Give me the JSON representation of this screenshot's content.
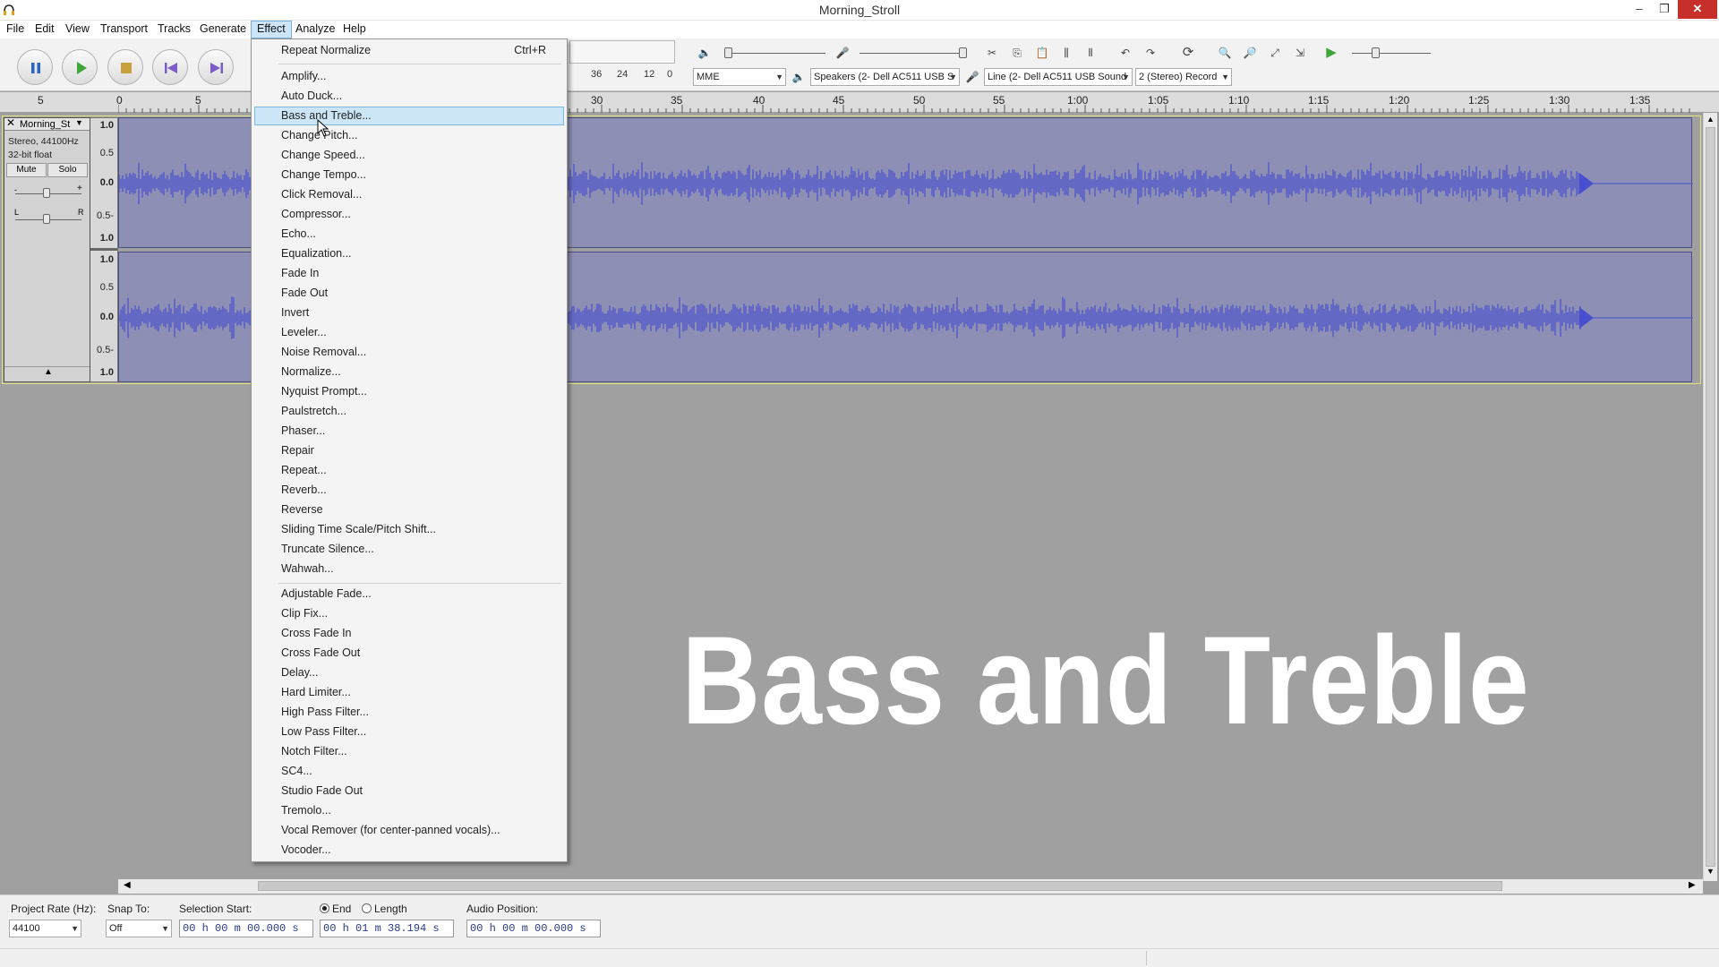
{
  "window": {
    "title": "Morning_Stroll",
    "min_icon": "minimize-icon",
    "max_icon": "restore-icon",
    "close_icon": "close-icon",
    "min_glyph": "–",
    "max_glyph": "❐",
    "close_glyph": "✕"
  },
  "menubar": [
    "File",
    "Edit",
    "View",
    "Transport",
    "Tracks",
    "Generate",
    "Effect",
    "Analyze",
    "Help"
  ],
  "open_menu": "Effect",
  "effect_menu": {
    "items": [
      {
        "label": "Repeat Normalize",
        "accel": "Ctrl+R"
      },
      {
        "label": "Amplify..."
      },
      {
        "label": "Auto Duck..."
      },
      {
        "label": "Bass and Treble...",
        "highlighted": true
      },
      {
        "label": "Change Pitch..."
      },
      {
        "label": "Change Speed..."
      },
      {
        "label": "Change Tempo..."
      },
      {
        "label": "Click Removal..."
      },
      {
        "label": "Compressor..."
      },
      {
        "label": "Echo..."
      },
      {
        "label": "Equalization..."
      },
      {
        "label": "Fade In"
      },
      {
        "label": "Fade Out"
      },
      {
        "label": "Invert"
      },
      {
        "label": "Leveler..."
      },
      {
        "label": "Noise Removal..."
      },
      {
        "label": "Normalize..."
      },
      {
        "label": "Nyquist Prompt..."
      },
      {
        "label": "Paulstretch..."
      },
      {
        "label": "Phaser..."
      },
      {
        "label": "Repair"
      },
      {
        "label": "Repeat..."
      },
      {
        "label": "Reverb..."
      },
      {
        "label": "Reverse"
      },
      {
        "label": "Sliding Time Scale/Pitch Shift..."
      },
      {
        "label": "Truncate Silence..."
      },
      {
        "label": "Wahwah..."
      },
      {
        "label": "Adjustable Fade..."
      },
      {
        "label": "Clip Fix..."
      },
      {
        "label": "Cross Fade In"
      },
      {
        "label": "Cross Fade Out"
      },
      {
        "label": "Delay..."
      },
      {
        "label": "Hard Limiter..."
      },
      {
        "label": "High Pass Filter..."
      },
      {
        "label": "Low Pass Filter..."
      },
      {
        "label": "Notch Filter..."
      },
      {
        "label": "SC4..."
      },
      {
        "label": "Studio Fade Out"
      },
      {
        "label": "Tremolo..."
      },
      {
        "label": "Vocal Remover (for center-panned vocals)..."
      },
      {
        "label": "Vocoder..."
      }
    ]
  },
  "transport": {
    "pause_icon": "pause-icon",
    "play_icon": "play-icon",
    "stop_icon": "stop-icon",
    "skip_start_icon": "skip-to-start-icon",
    "skip_end_icon": "skip-to-end-icon"
  },
  "meter": {
    "ticks": [
      "36",
      "24",
      "12",
      "0"
    ]
  },
  "device": {
    "host": "MME",
    "playback": "Speakers (2- Dell AC511 USB S",
    "recording": "Line (2- Dell AC511 USB Sound",
    "channels": "2 (Stereo) Record"
  },
  "ruler": {
    "labels": [
      "5",
      "0",
      "5",
      "30",
      "35",
      "40",
      "45",
      "50",
      "55",
      "1:00",
      "1:05",
      "1:10",
      "1:15",
      "1:20",
      "1:25",
      "1:30",
      "1:35"
    ]
  },
  "track": {
    "name": "Morning_St",
    "info1": "Stereo, 44100Hz",
    "info2": "32-bit float",
    "mute": "Mute",
    "solo": "Solo",
    "gain_minus": "-",
    "gain_plus": "+",
    "pan_left": "L",
    "pan_right": "R"
  },
  "vscale": {
    "top": [
      "1.0",
      "0.5",
      "0.0",
      "0.5-",
      "1.0"
    ],
    "bottom": [
      "1.0",
      "0.5",
      "0.0",
      "0.5-",
      "1.0"
    ]
  },
  "overlay_text": "Bass and Treble",
  "selection_toolbar": {
    "project_rate_label": "Project Rate (Hz):",
    "project_rate": "44100",
    "snap_label": "Snap To:",
    "snap": "Off",
    "sel_start_label": "Selection Start:",
    "sel_start": "00 h 00 m 00.000 s",
    "end_label": "End",
    "length_label": "Length",
    "end_value": "00 h 01 m 38.194 s",
    "audio_pos_label": "Audio Position:",
    "audio_pos": "00 h 00 m 00.000 s"
  },
  "colors": {
    "wave": "#4a4fd0",
    "wave_bg": "#8d90b4",
    "menu_highlight": "#cde6f7",
    "close": "#c7302a",
    "play": "#3fa63a"
  }
}
